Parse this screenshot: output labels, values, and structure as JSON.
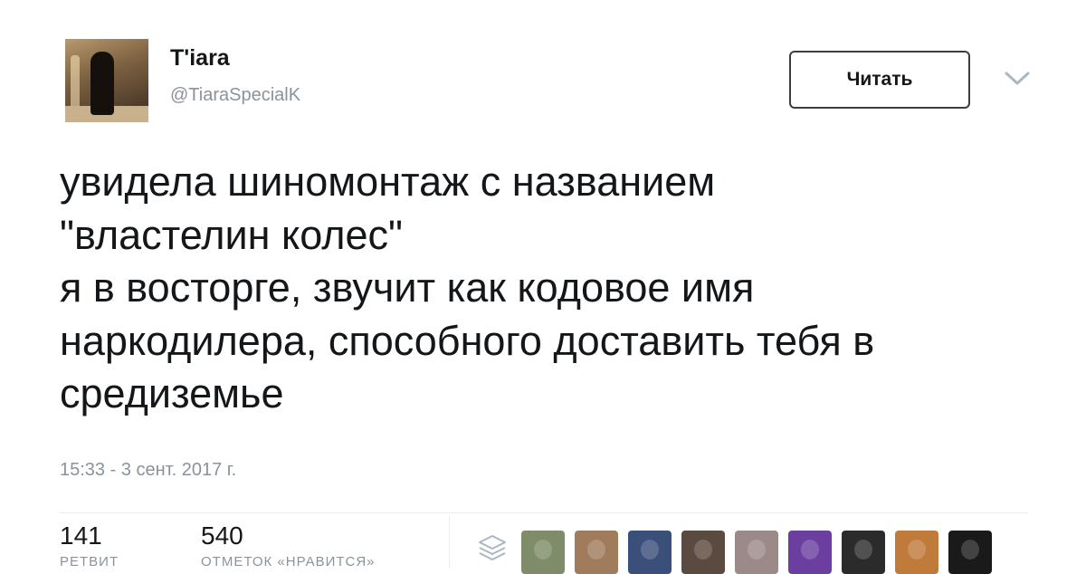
{
  "author": {
    "display_name": "T'iara",
    "handle": "@TiaraSpecialK"
  },
  "follow_button": {
    "label": "Читать"
  },
  "tweet": {
    "lines": [
      "увидела шиномонтаж с названием",
      "\"властелин колес\"",
      "я в восторге, звучит как кодовое имя",
      "наркодилера, способного доставить тебя в",
      "средиземье"
    ],
    "timestamp": "15:33 - 3 сент. 2017 г."
  },
  "stats": {
    "retweets": {
      "count": "141",
      "label": "РЕТВИТ"
    },
    "likes": {
      "count": "540",
      "label": "ОТМЕТОК «НРАВИТСЯ»"
    }
  },
  "likers": [
    {
      "color": "#7f8c6a"
    },
    {
      "color": "#a07c5c"
    },
    {
      "color": "#3a4f7a"
    },
    {
      "color": "#5b4a3f"
    },
    {
      "color": "#9b8a88"
    },
    {
      "color": "#6b3fa0"
    },
    {
      "color": "#2b2b2b"
    },
    {
      "color": "#c07a3a"
    },
    {
      "color": "#1a1a1a"
    }
  ],
  "colors": {
    "text": "#14171a",
    "secondary": "#8a939b",
    "divider": "#e6ecf0",
    "button_border": "#3d3d3d"
  }
}
